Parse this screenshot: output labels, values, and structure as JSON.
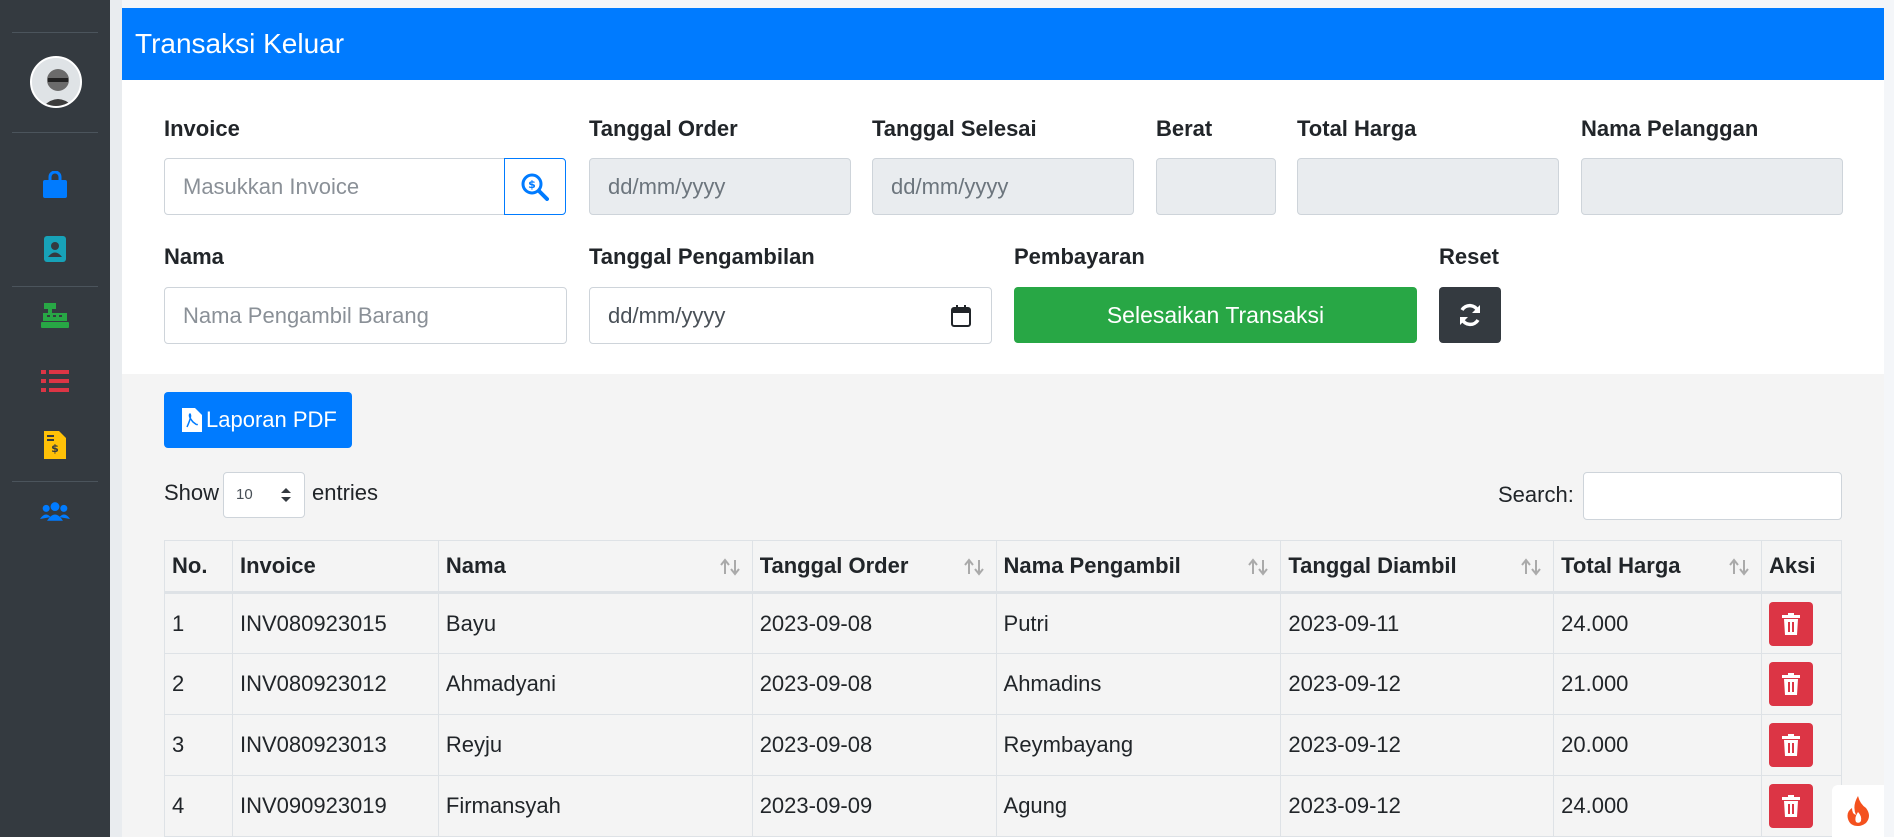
{
  "header": {
    "title": "Transaksi Keluar"
  },
  "form": {
    "invoice_label": "Invoice",
    "invoice_placeholder": "Masukkan Invoice",
    "tanggal_order_label": "Tanggal Order",
    "tanggal_order_value": "dd/mm/yyyy",
    "tanggal_selesai_label": "Tanggal Selesai",
    "tanggal_selesai_value": "dd/mm/yyyy",
    "berat_label": "Berat",
    "total_harga_label": "Total Harga",
    "nama_pelanggan_label": "Nama Pelanggan",
    "nama_label": "Nama",
    "nama_placeholder": "Nama Pengambil Barang",
    "tanggal_pengambilan_label": "Tanggal Pengambilan",
    "tanggal_pengambilan_value": "dd/mm/yyyy",
    "pembayaran_label": "Pembayaran",
    "selesaikan_button": "Selesaikan Transaksi",
    "reset_label": "Reset"
  },
  "toolbar": {
    "laporan_pdf": "Laporan PDF",
    "show_label": "Show",
    "entries_value": "10",
    "entries_label": "entries",
    "search_label": "Search:"
  },
  "table": {
    "headers": [
      "No.",
      "Invoice",
      "Nama",
      "Tanggal Order",
      "Nama Pengambil",
      "Tanggal Diambil",
      "Total Harga",
      "Aksi"
    ],
    "rows": [
      [
        "1",
        "INV080923015",
        "Bayu",
        "2023-09-08",
        "Putri",
        "2023-09-11",
        "24.000"
      ],
      [
        "2",
        "INV080923012",
        "Ahmadyani",
        "2023-09-08",
        "Ahmadins",
        "2023-09-12",
        "21.000"
      ],
      [
        "3",
        "INV080923013",
        "Reyju",
        "2023-09-08",
        "Reymbayang",
        "2023-09-12",
        "20.000"
      ],
      [
        "4",
        "INV090923019",
        "Firmansyah",
        "2023-09-09",
        "Agung",
        "2023-09-12",
        "24.000"
      ]
    ]
  },
  "sidebar": {
    "icons": [
      "shopping-bag-icon",
      "address-book-icon",
      "cash-register-icon",
      "list-icon",
      "invoice-dollar-icon",
      "users-icon"
    ],
    "colors": [
      "#007bff",
      "#17a2b8",
      "#28a745",
      "#dc3545",
      "#ffc107",
      "#007bff"
    ]
  },
  "colors": {
    "primary": "#007bff",
    "success": "#28a745",
    "danger": "#dc3545",
    "dark": "#343a40",
    "sidebar": "#343a40"
  }
}
